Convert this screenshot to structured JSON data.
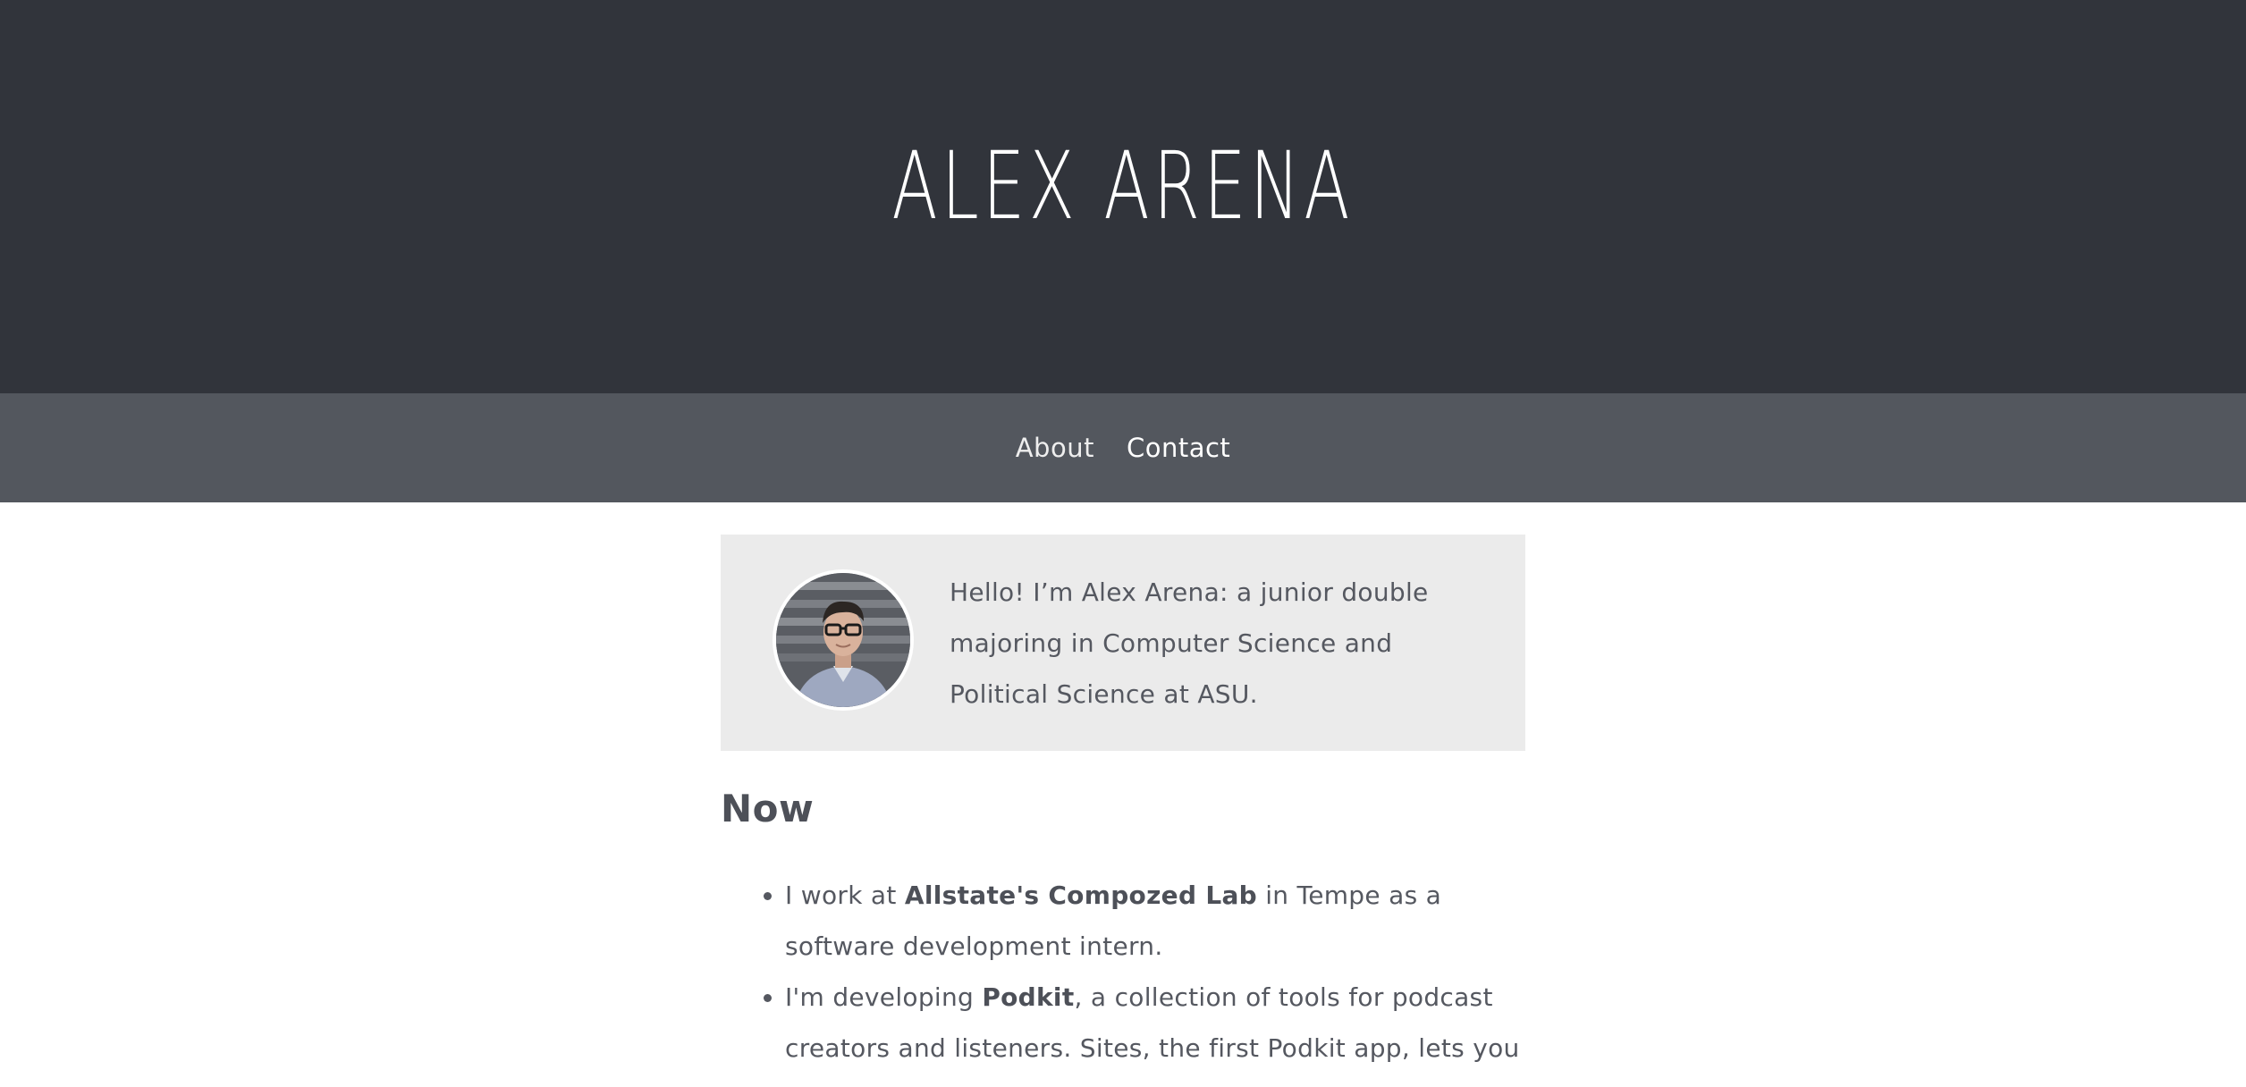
{
  "header": {
    "title": "ALEX ARENA"
  },
  "nav": {
    "items": [
      {
        "label": "About"
      },
      {
        "label": "Contact"
      }
    ]
  },
  "intro": {
    "avatar_icon": "profile-photo",
    "text": "Hello! I’m Alex Arena: a junior double majoring in Computer Science and Political Science at ASU."
  },
  "now": {
    "heading": "Now",
    "items": [
      {
        "before": "I work at ",
        "bold": "Allstate's Compozed Lab",
        "after": " in Tempe as a software development intern."
      },
      {
        "before": "I'm developing ",
        "bold": "Podkit",
        "after": ", a collection of tools for podcast creators and listeners. Sites, the first Podkit app, lets you"
      }
    ]
  }
}
